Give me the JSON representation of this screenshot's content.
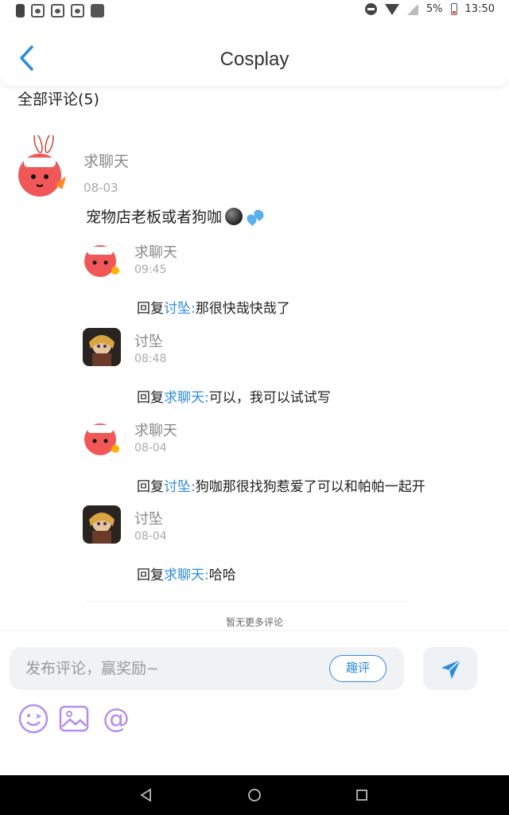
{
  "status_bar": {
    "battery": "5%",
    "time": "13:50"
  },
  "header": {
    "title": "Cosplay"
  },
  "comments": {
    "section_title": "全部评论(5)",
    "main": {
      "author": "求聊天",
      "date": "08-03",
      "text": "宠物店老板或者狗咖"
    },
    "replies": [
      {
        "author": "求聊天",
        "date": "09:45",
        "prefix": "回复",
        "target": "讨坠:",
        "text": "那很快哉快哉了"
      },
      {
        "author": "讨坠",
        "date": "08:48",
        "prefix": "回复",
        "target": "求聊天:",
        "text": "可以，我可以试试写"
      },
      {
        "author": "求聊天",
        "date": "08-04",
        "prefix": "回复",
        "target": "讨坠:",
        "text": "狗咖那很找狗惹爱了可以和帕帕一起开"
      },
      {
        "author": "讨坠",
        "date": "08-04",
        "prefix": "回复",
        "target": "求聊天:",
        "text": "哈哈"
      }
    ],
    "no_more": "暂无更多评论"
  },
  "composer": {
    "placeholder": "发布评论，赢奖励~",
    "quping_label": "趣评"
  },
  "colors": {
    "accent": "#2c8be0",
    "emoji_tools": "#b68cf0"
  }
}
